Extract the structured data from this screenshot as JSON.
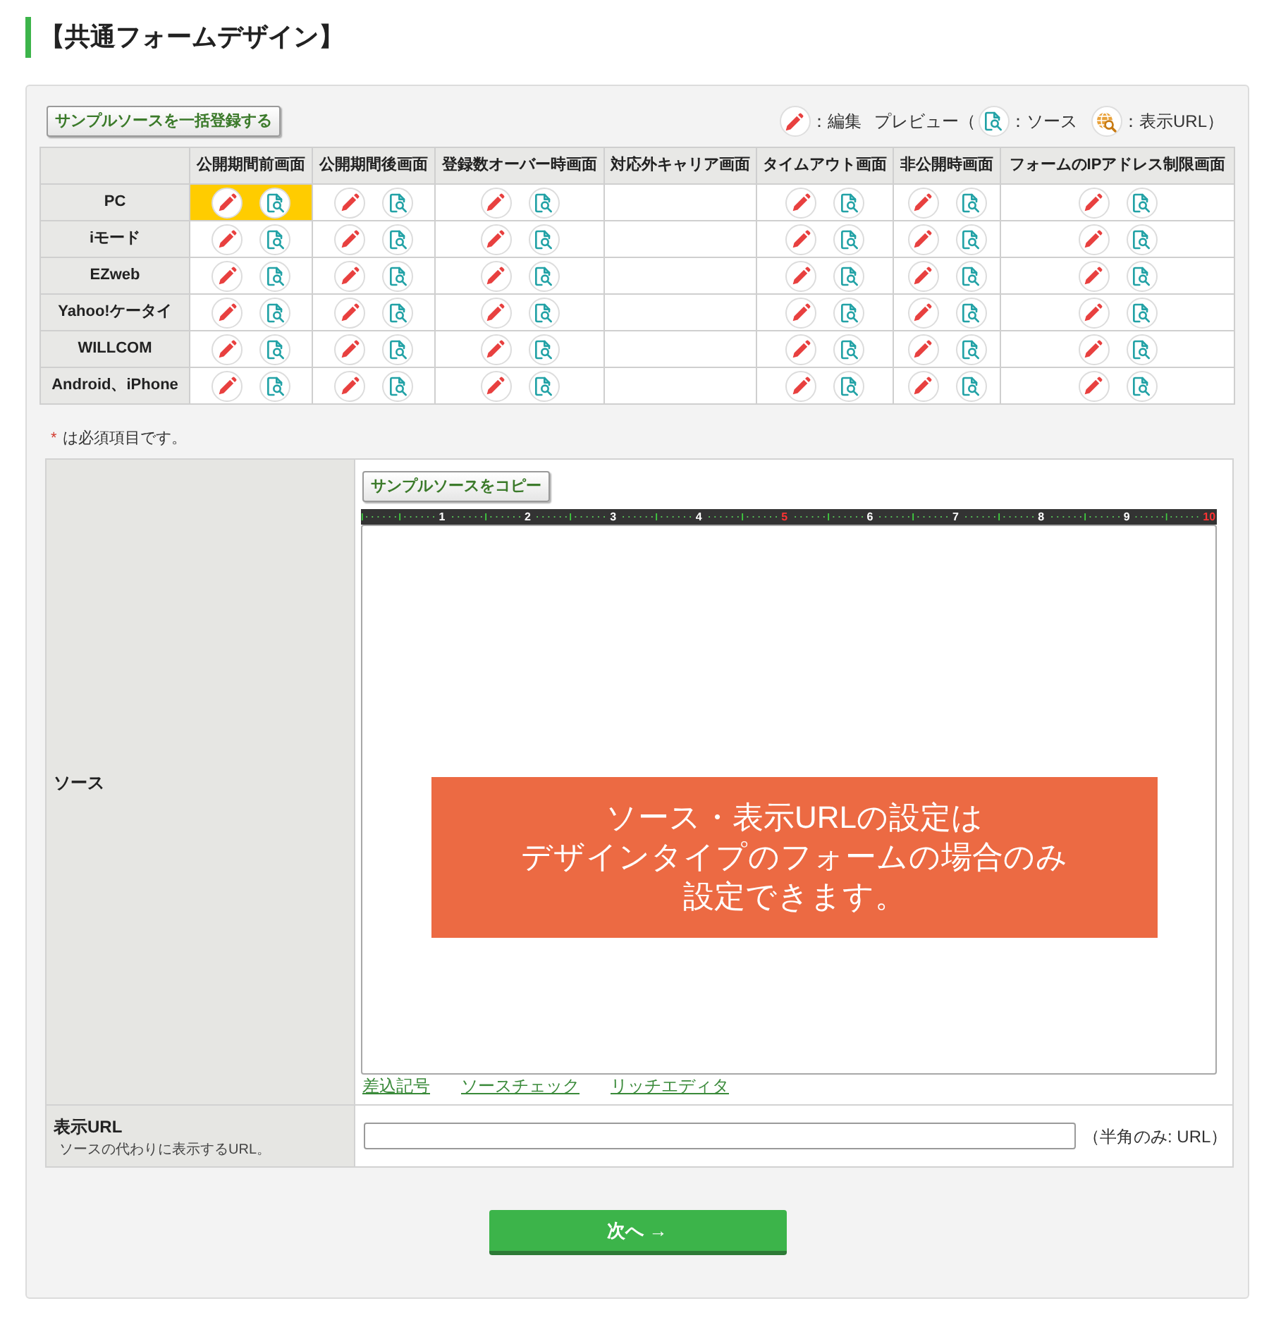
{
  "page_title": "【共通フォームデザイン】",
  "bulk_register_button": "サンプルソースを一括登録する",
  "legend": [
    {
      "kind": "edit",
      "label": "：編集"
    },
    {
      "kind": "plain",
      "label": "プレビュー（"
    },
    {
      "kind": "source",
      "label": "：ソース"
    },
    {
      "kind": "url",
      "label": "：表示URL）"
    }
  ],
  "design_table": {
    "columns": [
      "公開期間前画面",
      "公開期間後画面",
      "登録数オーバー時画面",
      "対応外キャリア画面",
      "タイムアウト画面",
      "非公開時画面",
      "フォームのIPアドレス制限画面"
    ],
    "rows": [
      {
        "label": "PC",
        "cells": [
          {
            "kind": "actions",
            "selected": true
          },
          {
            "kind": "actions",
            "selected": false
          },
          {
            "kind": "actions",
            "selected": false
          },
          {
            "kind": "empty",
            "selected": false
          },
          {
            "kind": "actions",
            "selected": false
          },
          {
            "kind": "actions",
            "selected": false
          },
          {
            "kind": "actions",
            "selected": false
          }
        ]
      },
      {
        "label": "iモード",
        "cells": [
          {
            "kind": "actions",
            "selected": false
          },
          {
            "kind": "actions",
            "selected": false
          },
          {
            "kind": "actions",
            "selected": false
          },
          {
            "kind": "empty",
            "selected": false
          },
          {
            "kind": "actions",
            "selected": false
          },
          {
            "kind": "actions",
            "selected": false
          },
          {
            "kind": "actions",
            "selected": false
          }
        ]
      },
      {
        "label": "EZweb",
        "cells": [
          {
            "kind": "actions",
            "selected": false
          },
          {
            "kind": "actions",
            "selected": false
          },
          {
            "kind": "actions",
            "selected": false
          },
          {
            "kind": "empty",
            "selected": false
          },
          {
            "kind": "actions",
            "selected": false
          },
          {
            "kind": "actions",
            "selected": false
          },
          {
            "kind": "actions",
            "selected": false
          }
        ]
      },
      {
        "label": "Yahoo!ケータイ",
        "cells": [
          {
            "kind": "actions",
            "selected": false
          },
          {
            "kind": "actions",
            "selected": false
          },
          {
            "kind": "actions",
            "selected": false
          },
          {
            "kind": "empty",
            "selected": false
          },
          {
            "kind": "actions",
            "selected": false
          },
          {
            "kind": "actions",
            "selected": false
          },
          {
            "kind": "actions",
            "selected": false
          }
        ]
      },
      {
        "label": "WILLCOM",
        "cells": [
          {
            "kind": "actions",
            "selected": false
          },
          {
            "kind": "actions",
            "selected": false
          },
          {
            "kind": "actions",
            "selected": false
          },
          {
            "kind": "empty",
            "selected": false
          },
          {
            "kind": "actions",
            "selected": false
          },
          {
            "kind": "actions",
            "selected": false
          },
          {
            "kind": "actions",
            "selected": false
          }
        ]
      },
      {
        "label": "Android、iPhone",
        "cells": [
          {
            "kind": "actions",
            "selected": false
          },
          {
            "kind": "actions",
            "selected": false
          },
          {
            "kind": "actions",
            "selected": false
          },
          {
            "kind": "empty",
            "selected": false
          },
          {
            "kind": "actions",
            "selected": false
          },
          {
            "kind": "actions",
            "selected": false
          },
          {
            "kind": "actions",
            "selected": false
          }
        ]
      }
    ]
  },
  "required_note": {
    "mark": "*",
    "text": "は必須項目です。"
  },
  "form": {
    "source": {
      "label": "ソース",
      "copy_button": "サンプルソースをコピー",
      "ruler": [
        {
          "text": "1",
          "color": "#ffffff"
        },
        {
          "text": "2",
          "color": "#ffffff"
        },
        {
          "text": "3",
          "color": "#ffffff"
        },
        {
          "text": "4",
          "color": "#ffffff"
        },
        {
          "text": "5",
          "color": "#ff3333"
        },
        {
          "text": "6",
          "color": "#ffffff"
        },
        {
          "text": "7",
          "color": "#ffffff"
        },
        {
          "text": "8",
          "color": "#ffffff"
        },
        {
          "text": "9",
          "color": "#ffffff"
        },
        {
          "text": "10",
          "color": "#ff3333"
        }
      ],
      "notice": [
        "ソース・表示URLの設定は",
        "デザインタイプのフォームの場合のみ",
        "設定できます。"
      ],
      "links": [
        "差込記号",
        "ソースチェック",
        "リッチエディタ"
      ]
    },
    "url": {
      "label": "表示URL",
      "hint": "ソースの代わりに表示するURL。",
      "note": "（半角のみ: URL）"
    }
  },
  "next_button": "次へ →"
}
